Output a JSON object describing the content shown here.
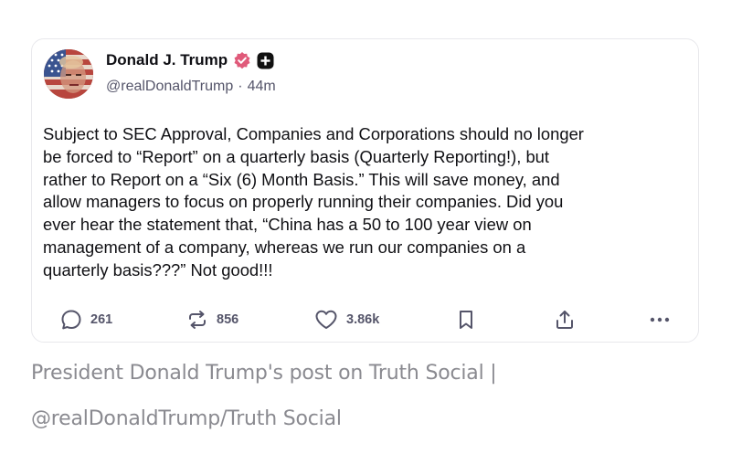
{
  "post": {
    "author": {
      "display_name": "Donald J. Trump",
      "handle": "@realDonaldTrump",
      "separator": "·",
      "time_ago": "44m",
      "verified_icon": "verified-badge-icon",
      "plus_icon": "plus-badge-icon",
      "avatar_icon": "american-flag-portrait-avatar"
    },
    "text": "Subject to SEC Approval, Companies and Corporations should no longer\nbe forced to “Report” on a quarterly basis (Quarterly Reporting!), but\nrather to Report on a “Six (6) Month Basis.” This will save money, and\nallow managers to focus on properly running their companies. Did you\never hear the statement that, “China has a 50 to 100 year view on\nmanagement of a company, whereas we run our companies on a\nquarterly basis???” Not good!!!",
    "actions": {
      "reply_count": "261",
      "retruth_count": "856",
      "like_count": "3.86k"
    },
    "colors": {
      "verified_badge": "#e05a7a",
      "plus_badge": "#111111",
      "icon_gray": "#55556a"
    }
  },
  "caption": {
    "line1": "President Donald Trump's post on Truth Social |",
    "line2": "@realDonaldTrump/Truth Social"
  }
}
